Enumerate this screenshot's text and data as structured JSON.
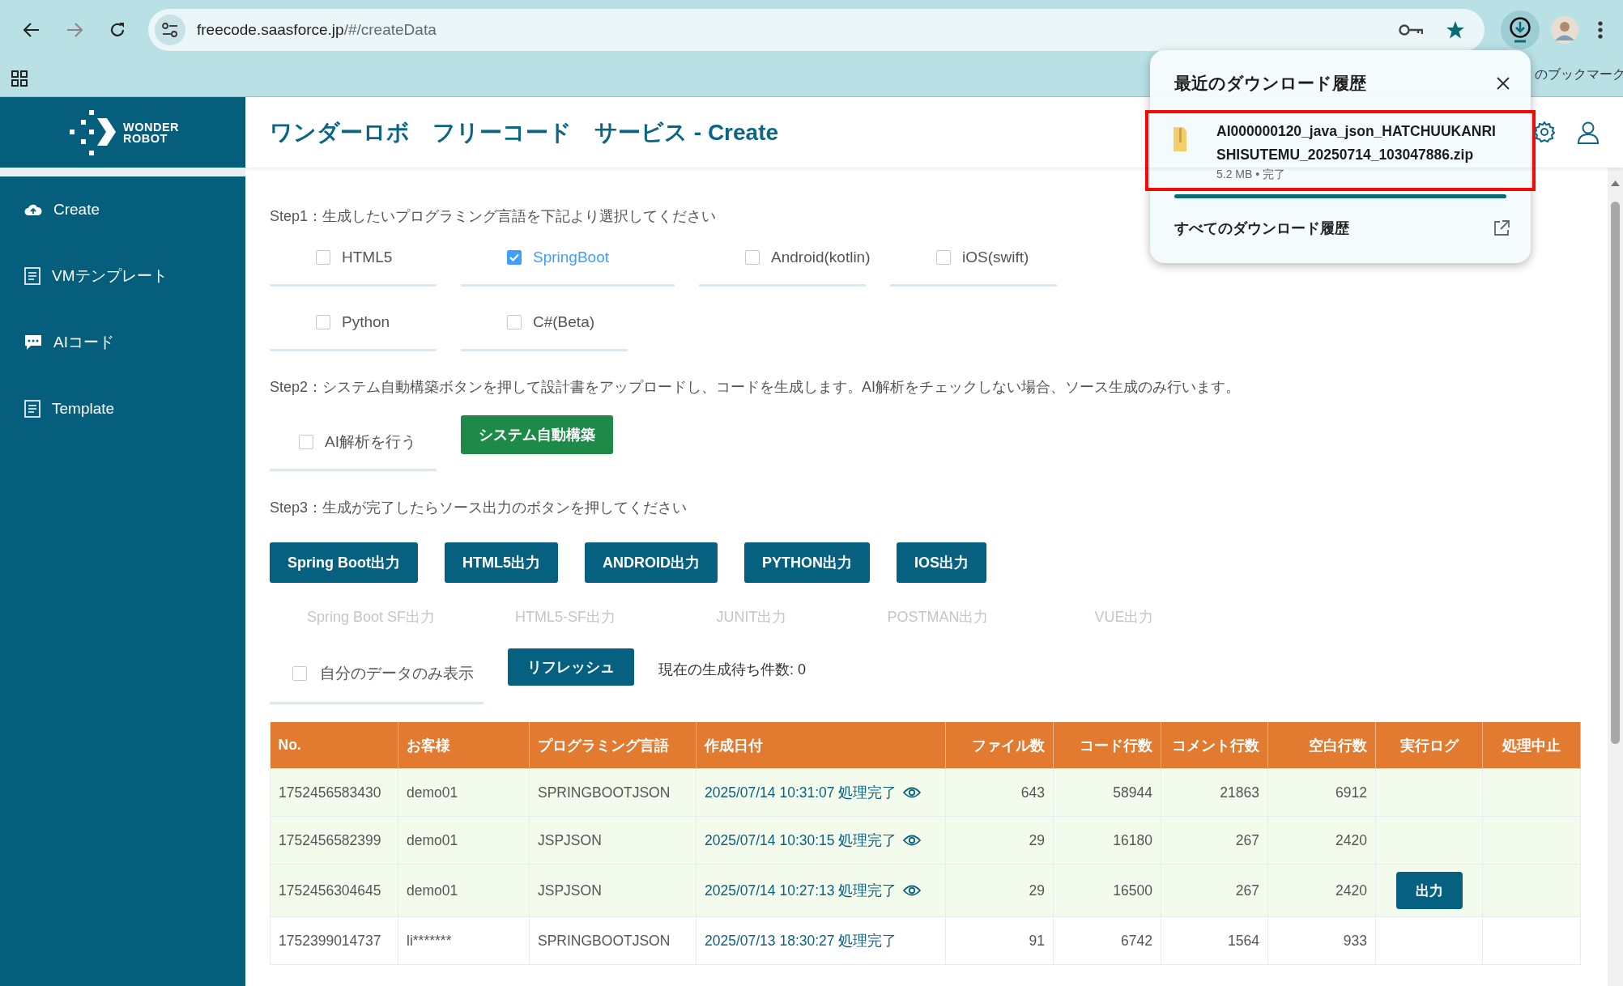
{
  "browser": {
    "address": {
      "host": "freecode.saasforce.jp",
      "path": "/#/createData"
    },
    "bookmarks_bar": {
      "partial_label": "のブックマーク"
    }
  },
  "download_popup": {
    "title": "最近のダウンロード履歴",
    "items": [
      {
        "file_name_lines": [
          "AI000000120_java_json_HATCHUUKANRI",
          "SHISUTEMU_20250714_103047886.zip"
        ],
        "meta": "5.2 MB • 完了",
        "highlighted": true
      }
    ],
    "footer_link": "すべてのダウンロード履歴"
  },
  "sidebar": {
    "logo": {
      "line_1": "WONDER",
      "line_2": "ROBOT"
    },
    "items": [
      {
        "label": "Create",
        "selected": false
      },
      {
        "label": "VMテンプレート",
        "selected": false
      },
      {
        "label": "AIコード",
        "selected": false
      },
      {
        "label": "Template",
        "selected": false
      }
    ]
  },
  "header": {
    "title": "ワンダーロボ　フリーコード　サービス - Create"
  },
  "step1": {
    "instruction": "Step1：生成したいプログラミング言語を下記より選択してください",
    "options": [
      {
        "label": "HTML5",
        "checked": false
      },
      {
        "label": "SpringBoot",
        "checked": true
      },
      {
        "label": "Android(kotlin)",
        "checked": false
      },
      {
        "label": "iOS(swift)",
        "checked": false
      },
      {
        "label": "Python",
        "checked": false
      },
      {
        "label": "C#(Beta)",
        "checked": false
      }
    ]
  },
  "step2": {
    "instruction": "Step2：システム自動構築ボタンを押して設計書をアップロードし、コードを生成します。AI解析をチェックしない場合、ソース生成のみ行います。",
    "ai_option": {
      "label": "AI解析を行う",
      "checked": false
    },
    "build_button": "システム自動構築"
  },
  "step3": {
    "instruction": "Step3：生成が完了したらソース出力のボタンを押してください",
    "output_buttons": [
      "Spring Boot出力",
      "HTML5出力",
      "ANDROID出力",
      "PYTHON出力",
      "IOS出力"
    ],
    "extra_outputs": [
      {
        "label": "Spring Boot SF出力",
        "disabled": true
      },
      {
        "label": "HTML5-SF出力",
        "disabled": true
      },
      {
        "label": "JUNIT出力",
        "disabled": true
      },
      {
        "label": "POSTMAN出力",
        "disabled": true
      },
      {
        "label": "VUE出力",
        "disabled": true
      }
    ]
  },
  "filter": {
    "my_data_only": {
      "label": "自分のデータのみ表示",
      "checked": false
    },
    "refresh_button": "リフレッシュ",
    "queue_status": "現在の生成待ち件数: 0"
  },
  "table": {
    "columns": [
      "No.",
      "お客様",
      "プログラミング言語",
      "作成日付",
      "ファイル数",
      "コード行数",
      "コメント行数",
      "空白行数",
      "実行ログ",
      "処理中止"
    ],
    "rows": [
      {
        "no": "1752456583430",
        "customer": "demo01",
        "language": "SPRINGBOOTJSON",
        "created": "2025/07/14 10:31:07 処理完了",
        "viewable": true,
        "files": "643",
        "code_lines": "58944",
        "comment_lines": "21863",
        "blank_lines": "6912",
        "highlighted": true
      },
      {
        "no": "1752456582399",
        "customer": "demo01",
        "language": "JSPJSON",
        "created": "2025/07/14 10:30:15 処理完了",
        "viewable": true,
        "files": "29",
        "code_lines": "16180",
        "comment_lines": "267",
        "blank_lines": "2420",
        "highlighted": true
      },
      {
        "no": "1752456304645",
        "customer": "demo01",
        "language": "JSPJSON",
        "created": "2025/07/14 10:27:13 処理完了",
        "viewable": true,
        "files": "29",
        "code_lines": "16500",
        "comment_lines": "267",
        "blank_lines": "2420",
        "log_button": "出力",
        "highlighted": true
      },
      {
        "no": "1752399014737",
        "customer": "li*******",
        "language": "SPRINGBOOTJSON",
        "created": "2025/07/13 18:30:27 処理完了",
        "viewable": false,
        "files": "91",
        "code_lines": "6742",
        "comment_lines": "1564",
        "blank_lines": "933",
        "highlighted": false
      }
    ]
  }
}
